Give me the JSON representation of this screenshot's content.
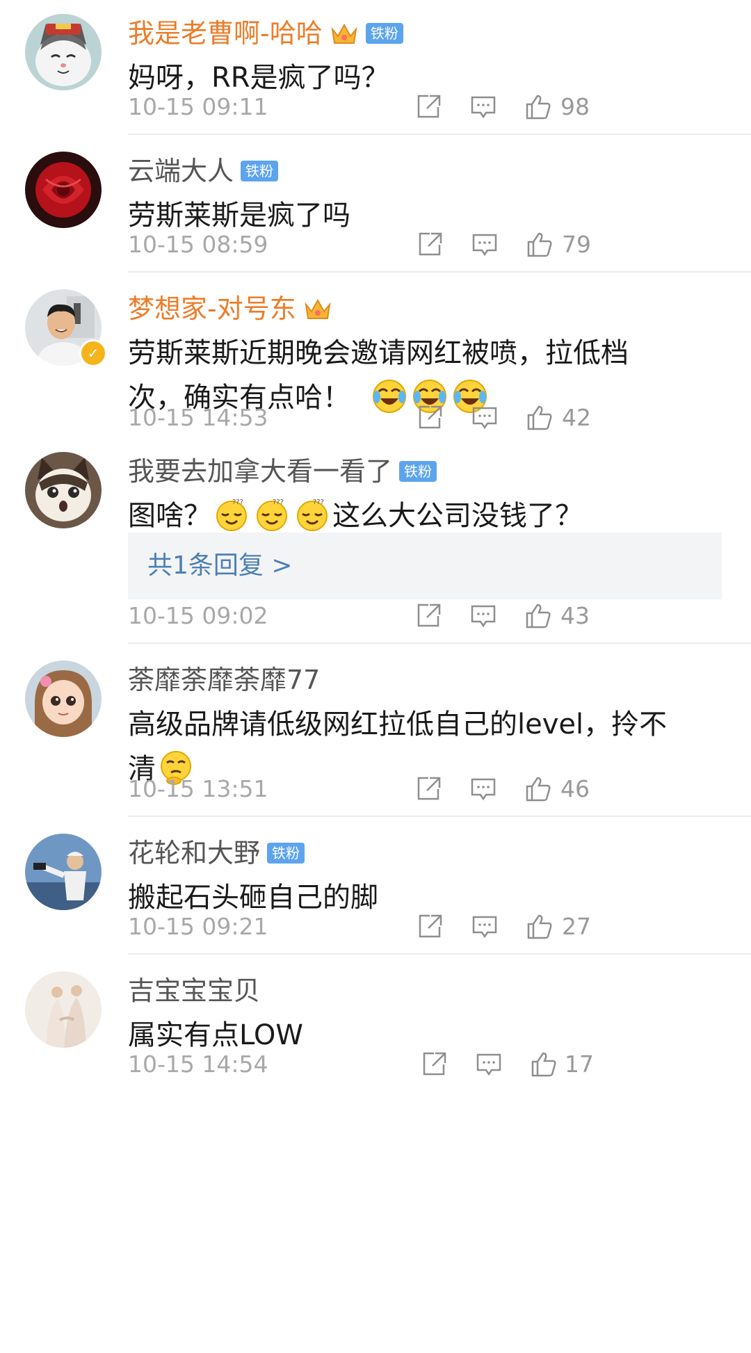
{
  "comments": [
    {
      "username": "我是老曹啊-哈哈",
      "badge": "铁粉",
      "lines": [
        "妈呀，RR是疯了吗？"
      ],
      "time": "10-15 09:11",
      "likes": "98"
    },
    {
      "username": "云端大人",
      "badge": "铁粉",
      "lines": [
        "劳斯莱斯是疯了吗"
      ],
      "time": "10-15 08:59",
      "likes": "79"
    },
    {
      "username": "梦想家-对号东",
      "lines": [
        "劳斯莱斯近期晚会邀请网红被喷，拉低档",
        "次，确实有点哈！"
      ],
      "time": "10-15 14:53",
      "likes": "42"
    },
    {
      "username": "我要去加拿大看一看了",
      "badge": "铁粉",
      "lines": [
        "图啥？",
        "这么大公司没钱了？"
      ],
      "reply": "共1条回复 >",
      "time": "10-15 09:02",
      "likes": "43"
    },
    {
      "username": "荼靡荼靡荼靡77",
      "lines": [
        "高级品牌请低级网红拉低自己的level，拎不",
        "清"
      ],
      "time": "10-15 13:51",
      "likes": "46"
    },
    {
      "username": "花轮和大野",
      "badge": "铁粉",
      "lines": [
        "搬起石头砸自己的脚"
      ],
      "time": "10-15 09:21",
      "likes": "27"
    },
    {
      "username": "吉宝宝宝贝",
      "lines": [
        "属实有点LOW"
      ],
      "time": "10-15 14:54",
      "likes": "17"
    }
  ],
  "icons": {
    "share": "share-icon",
    "comment": "comment-icon",
    "like": "thumbs-up-icon",
    "vip": "crown-icon",
    "verified": "verified-icon"
  },
  "colors": {
    "vip_name": "#ec7d29",
    "fan_badge": "#5da4ee",
    "reply_link": "#4d7fb5",
    "meta_gray": "#a8a8a8"
  }
}
